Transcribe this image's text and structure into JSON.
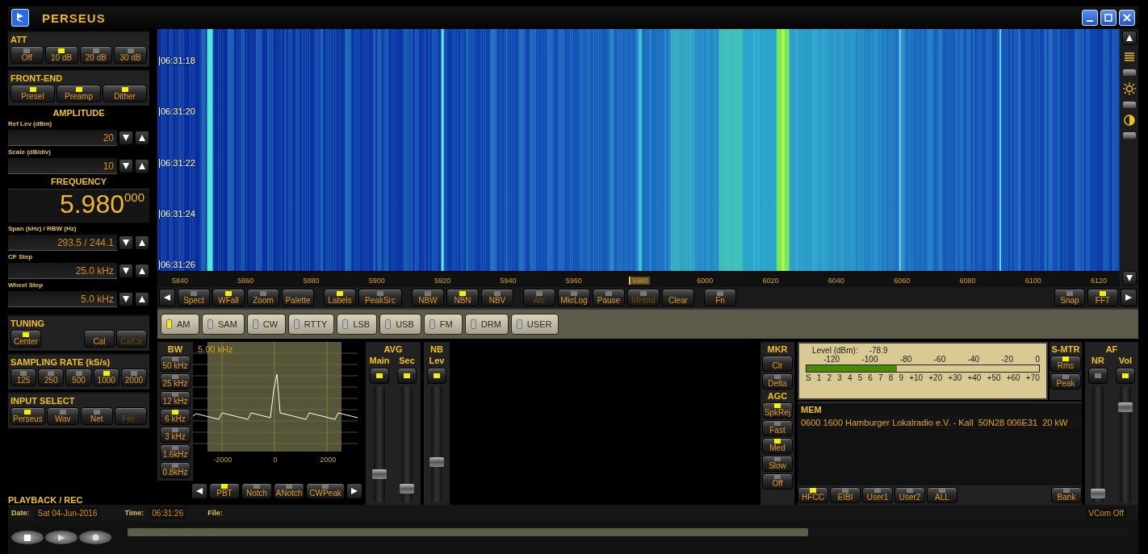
{
  "window": {
    "title": "PERSEUS"
  },
  "att": {
    "title": "ATT",
    "buttons": [
      {
        "label": "Off",
        "on": false
      },
      {
        "label": "10 dB",
        "on": true
      },
      {
        "label": "20 dB",
        "on": false
      },
      {
        "label": "30 dB",
        "on": false
      }
    ]
  },
  "front_end": {
    "title": "FRONT-END",
    "buttons": [
      {
        "label": "Presel",
        "on": true
      },
      {
        "label": "Preamp",
        "on": true
      },
      {
        "label": "Dither",
        "on": true
      }
    ]
  },
  "amplitude": {
    "title": "AMPLITUDE",
    "fields": [
      {
        "label": "Ref Lev (dBm)",
        "value": "20"
      },
      {
        "label": "Scale (dB/div)",
        "value": "10"
      }
    ]
  },
  "frequency": {
    "title": "FREQUENCY",
    "value": "5.980",
    "value_fraction": "000"
  },
  "steps": [
    {
      "label": "Span (kHz) / RBW (Hz)",
      "value": "293.5 / 244.1"
    },
    {
      "label": "CF Step",
      "value": "25.0 kHz"
    },
    {
      "label": "Wheel Step",
      "value": "5.0 kHz"
    }
  ],
  "tuning": {
    "title": "TUNING",
    "buttons": [
      {
        "label": "Center",
        "kind": "led",
        "on": true,
        "disabled": false
      },
      {
        "label": "Cal",
        "kind": "plain",
        "disabled": false
      },
      {
        "label": "CalClr",
        "kind": "plain",
        "disabled": true
      }
    ]
  },
  "sampling_rate": {
    "title": "SAMPLING RATE (kS/s)",
    "buttons": [
      {
        "label": "125",
        "on": false
      },
      {
        "label": "250",
        "on": false
      },
      {
        "label": "500",
        "on": false
      },
      {
        "label": "1000",
        "on": true
      },
      {
        "label": "2000",
        "on": false
      }
    ]
  },
  "input_select": {
    "title": "INPUT SELECT",
    "buttons": [
      {
        "label": "Perseus",
        "kind": "led",
        "on": true,
        "disabled": false
      },
      {
        "label": "Wav",
        "kind": "led",
        "on": false,
        "disabled": false
      },
      {
        "label": "Net",
        "kind": "led",
        "on": false,
        "disabled": false
      },
      {
        "label": "File..",
        "kind": "plain",
        "disabled": true
      }
    ]
  },
  "playback": {
    "title": "PLAYBACK / REC"
  },
  "waterfall": {
    "time_labels": [
      "06:31:18",
      "06:31:20",
      "06:31:22",
      "06:31:24",
      "06:31:26"
    ]
  },
  "frequency_axis": {
    "labels": [
      {
        "text": "5840",
        "selected": false
      },
      {
        "text": "5860",
        "selected": false
      },
      {
        "text": "5880",
        "selected": false
      },
      {
        "text": "5900",
        "selected": false
      },
      {
        "text": "5920",
        "selected": false
      },
      {
        "text": "5940",
        "selected": false
      },
      {
        "text": "5960",
        "selected": false
      },
      {
        "text": "5980",
        "selected": true
      },
      {
        "text": "6000",
        "selected": false
      },
      {
        "text": "6020",
        "selected": false
      },
      {
        "text": "6040",
        "selected": false
      },
      {
        "text": "6060",
        "selected": false
      },
      {
        "text": "6080",
        "selected": false
      },
      {
        "text": "6100",
        "selected": false
      },
      {
        "text": "6120",
        "selected": false
      }
    ]
  },
  "toolbar": {
    "buttons": [
      {
        "label": "Spect",
        "kind": "led",
        "on": false,
        "disabled": false
      },
      {
        "label": "WFall",
        "kind": "led",
        "on": true,
        "disabled": false
      },
      {
        "label": "Zoom",
        "kind": "led",
        "on": false,
        "disabled": false
      },
      {
        "label": "Palette",
        "kind": "plain",
        "disabled": false
      },
      {
        "label": "Labels",
        "kind": "led",
        "on": true,
        "disabled": false
      },
      {
        "label": "PeakSrc",
        "kind": "led",
        "on": false,
        "disabled": false
      },
      {
        "label": "NBW",
        "kind": "led",
        "on": false,
        "disabled": false
      },
      {
        "label": "NBN",
        "kind": "led",
        "on": true,
        "disabled": false
      },
      {
        "label": "NBV",
        "kind": "led",
        "on": false,
        "disabled": false
      },
      {
        "label": "Afc",
        "kind": "led",
        "on": false,
        "disabled": true
      },
      {
        "label": "MkrLog",
        "kind": "led",
        "on": false,
        "disabled": false
      },
      {
        "label": "Pause",
        "kind": "led",
        "on": false,
        "disabled": false
      },
      {
        "label": "MHold",
        "kind": "led",
        "on": false,
        "disabled": true
      },
      {
        "label": "Clear",
        "kind": "plain",
        "disabled": false
      },
      {
        "label": "Fn",
        "kind": "led",
        "on": false,
        "disabled": false
      }
    ],
    "right_buttons": [
      {
        "label": "Snap",
        "on": false
      },
      {
        "label": "FFT",
        "on": true
      }
    ]
  },
  "modes": [
    {
      "label": "AM",
      "selected": true
    },
    {
      "label": "SAM",
      "selected": false
    },
    {
      "label": "CW",
      "selected": false
    },
    {
      "label": "RTTY",
      "selected": false
    },
    {
      "label": "LSB",
      "selected": false
    },
    {
      "label": "USB",
      "selected": false
    },
    {
      "label": "FM",
      "selected": false
    },
    {
      "label": "DRM",
      "selected": false
    },
    {
      "label": "USER",
      "selected": false
    }
  ],
  "bandwidth": {
    "title": "BW",
    "buttons": [
      {
        "label": "50 kHz",
        "on": false
      },
      {
        "label": "25 kHz",
        "on": false
      },
      {
        "label": "12 kHz",
        "on": false
      },
      {
        "label": "6 kHz",
        "on": true
      },
      {
        "label": "3 kHz",
        "on": false
      },
      {
        "label": "1.6kHz",
        "on": false
      },
      {
        "label": "0.8kHz",
        "on": false
      }
    ]
  },
  "filter_display": {
    "readout": "5.00 kHz",
    "axis_labels": [
      "-2000",
      "0",
      "2000"
    ]
  },
  "filter_buttons": [
    {
      "label": "PBT",
      "on": true
    },
    {
      "label": "Notch",
      "on": false
    },
    {
      "label": "ANotch",
      "on": false
    },
    {
      "label": "CWPeak",
      "on": false
    }
  ],
  "avg": {
    "title": "AVG",
    "channels": [
      {
        "label": "Main",
        "on": true,
        "level": 0.22
      },
      {
        "label": "Sec",
        "on": true,
        "level": 0.08
      }
    ]
  },
  "nb": {
    "title": "NB",
    "channels": [
      {
        "label": "Lev",
        "on": true,
        "level": 0.33
      }
    ]
  },
  "marker_panel": {
    "title": "MKR",
    "buttons": [
      {
        "label": "Clr",
        "kind": "plain"
      },
      {
        "label": "Delta",
        "kind": "led",
        "on": false
      }
    ]
  },
  "agc": {
    "title": "AGC",
    "buttons": [
      {
        "label": "SpkRej",
        "on": true
      },
      {
        "label": "Fast",
        "on": false
      },
      {
        "label": "Med",
        "on": true
      },
      {
        "label": "Slow",
        "on": false
      },
      {
        "label": "Off",
        "on": false
      }
    ]
  },
  "s_meter": {
    "reading_label": "Level (dBm):",
    "reading": "-78.9",
    "dbm_scale": [
      "-120",
      "-100",
      "-80",
      "-60",
      "-40",
      "-20",
      "0"
    ],
    "s_scale": [
      "S",
      "1",
      "2",
      "3",
      "4",
      "5",
      "6",
      "7",
      "8",
      "9",
      "+10",
      "+20",
      "+30",
      "+40",
      "+50",
      "+60",
      "+70"
    ],
    "level": 0.39
  },
  "s_mtr": {
    "title": "S-MTR",
    "buttons": [
      {
        "label": "Rms",
        "on": true
      },
      {
        "label": "Peak",
        "on": false
      }
    ]
  },
  "memory": {
    "title": "MEM",
    "entry": "0600 1600 Hamburger Lokalradio e.V. - Kall  50N28 006E31  20 kW",
    "buttons": [
      {
        "label": "HFCC",
        "on": true
      },
      {
        "label": "EIBI",
        "on": false
      },
      {
        "label": "User1",
        "on": false
      },
      {
        "label": "User2",
        "on": false
      },
      {
        "label": "ALL",
        "on": false
      }
    ],
    "bank_button": {
      "label": "Bank",
      "on": false
    }
  },
  "af": {
    "title": "AF",
    "channels": [
      {
        "label": "NR",
        "on": false,
        "level": 0.04
      },
      {
        "label": "Vol",
        "on": true,
        "level": 0.85
      }
    ]
  },
  "playback_position": {
    "level": 0.68
  },
  "status_bar": {
    "date_label": "Date:",
    "date": "Sat 04-Jun-2016",
    "time_label": "Time:",
    "time": "06:31:26",
    "file_label": "File:",
    "vcom": "VCom Off"
  }
}
